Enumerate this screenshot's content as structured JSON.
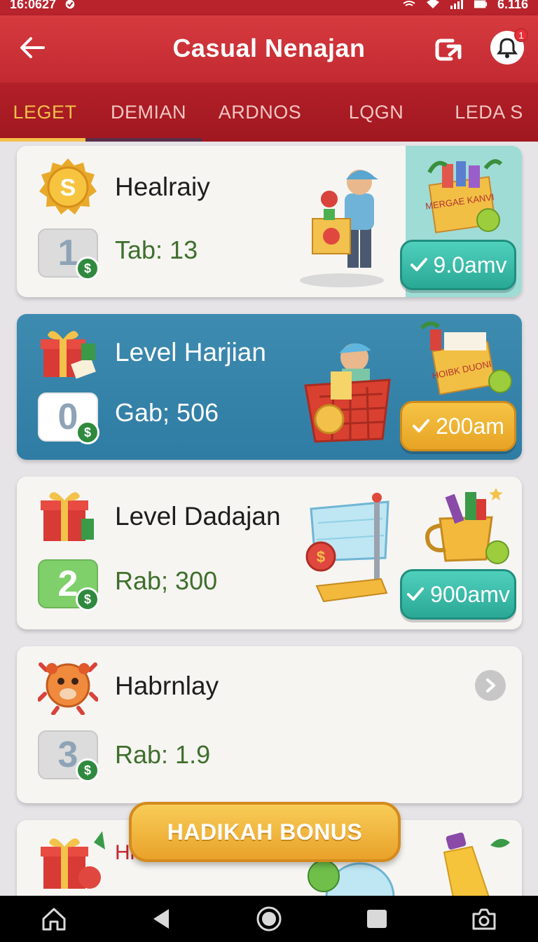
{
  "status_bar": {
    "time": "16:0627",
    "battery": "6.116"
  },
  "app_bar": {
    "title": "Casual Nenajan",
    "notification_count": "1"
  },
  "tabs": [
    {
      "label": "LEGET",
      "active": true
    },
    {
      "label": "DEMIAN",
      "active": false
    },
    {
      "label": "ARDNOS",
      "active": false
    },
    {
      "label": "LQGN",
      "active": false
    },
    {
      "label": "LEDA S",
      "active": false
    }
  ],
  "cards": [
    {
      "title": "Healraiy",
      "level": "1",
      "sub": "Tab: 13",
      "reward": "9.0amv",
      "promo_text": "MERGAE KANVI"
    },
    {
      "title": "Level Harjian",
      "level": "0",
      "sub": "Gab; 506",
      "reward": "200am",
      "promo_text": "HOIBK DUONI"
    },
    {
      "title": "Level Dadajan",
      "level": "2",
      "sub": "Rab; 300",
      "reward": "900amv"
    },
    {
      "title": "Habrnlay",
      "level": "3",
      "sub": "Rab: 1.9"
    },
    {
      "title": "Hi"
    }
  ],
  "bonus_button": {
    "label": "HADIKAH BONUS"
  },
  "colors": {
    "primary": "#c22a31",
    "accent": "#f5c04a",
    "teal": "#2aa896",
    "blue_card": "#3a87ad"
  },
  "icons": [
    "back-arrow-icon",
    "share-icon",
    "notification-icon",
    "coin-icon",
    "gift-icon",
    "monster-icon",
    "home-icon",
    "back-nav-icon",
    "circle-nav-icon",
    "square-nav-icon",
    "camera-nav-icon"
  ]
}
